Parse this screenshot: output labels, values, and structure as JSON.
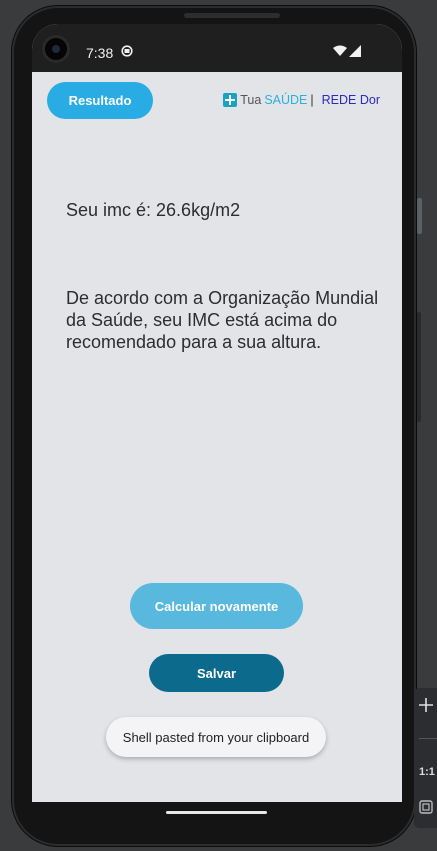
{
  "status_bar": {
    "time": "7:38"
  },
  "header": {
    "result_button_label": "Resultado",
    "brand": {
      "tua": "Tua",
      "saude": "SAÚDE",
      "separator": "|",
      "rede": "REDE Dor"
    }
  },
  "main": {
    "imc_text": "Seu imc é: 26.6kg/m2",
    "message": "De acordo com a Organização Mundial da Saúde, seu IMC está acima do recomendado para a sua altura.",
    "recalculate_label": "Calcular novamente",
    "save_label": "Salvar"
  },
  "toast": {
    "text": "Shell pasted from your clipboard"
  },
  "emulator_toolbar": {
    "ratio_label": "1:1"
  },
  "colors": {
    "accent_blue": "#29ace3",
    "recalc_blue": "#58b8de",
    "save_dark_blue": "#0c6a8d",
    "brand_saude": "#2bb0dd",
    "brand_rede": "#2a2abd",
    "screen_background": "#e2e4e8"
  },
  "icons": [
    "camera-icon",
    "app-status-icon",
    "wifi-icon",
    "signal-icon",
    "plus-icon",
    "emulator-plus-icon",
    "emulator-frame-icon"
  ]
}
